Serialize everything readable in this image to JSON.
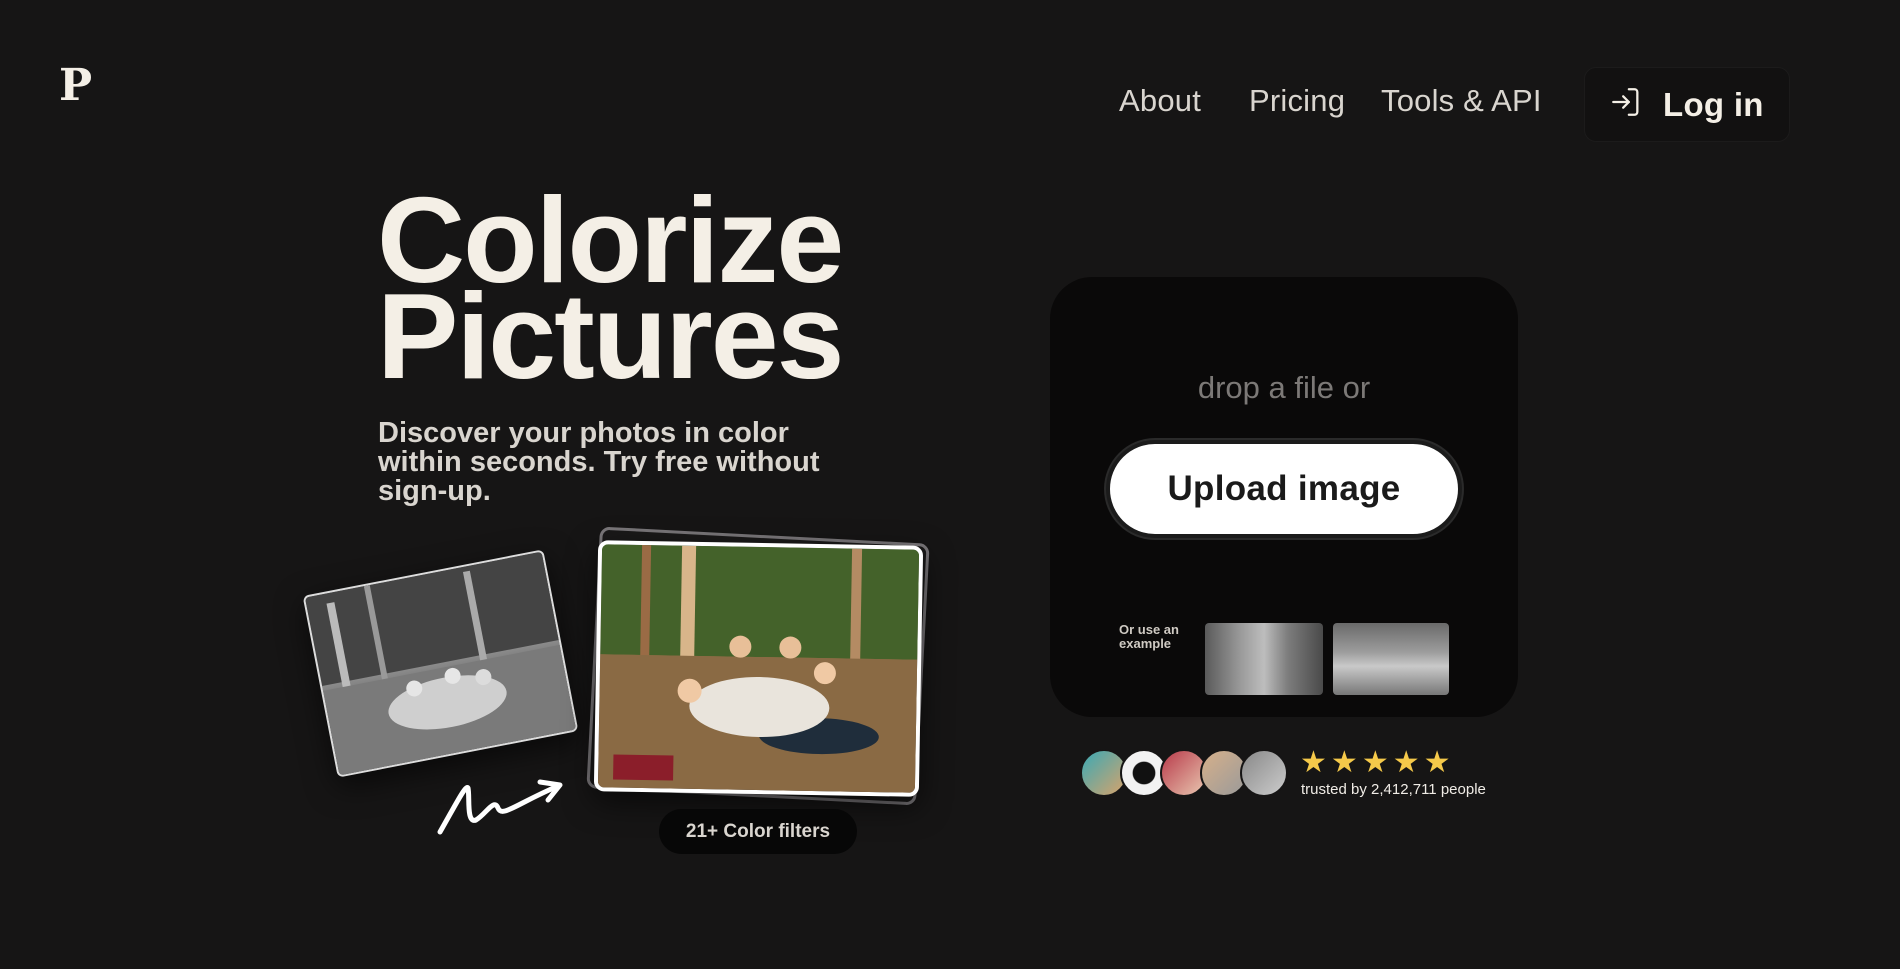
{
  "brand": {
    "logo": "P"
  },
  "nav": {
    "about": "About",
    "pricing": "Pricing",
    "tools": "Tools & API",
    "login": "Log in"
  },
  "hero": {
    "title_line1": "Colorize",
    "title_line2": "Pictures",
    "subtitle": "Discover your photos in color within seconds. Try free without sign-up.",
    "filters_badge": "21+ Color filters"
  },
  "upload": {
    "drop_text": "drop a file or",
    "button_label": "Upload image",
    "examples_label": "Or use an example"
  },
  "social_proof": {
    "stars": [
      "★",
      "★",
      "★",
      "★",
      "★"
    ],
    "trusted_text": "trusted by 2,412,711 people"
  },
  "colors": {
    "background": "#161515",
    "card": "#0a0909",
    "text": "#f4efe6",
    "star": "#f5c94a"
  }
}
